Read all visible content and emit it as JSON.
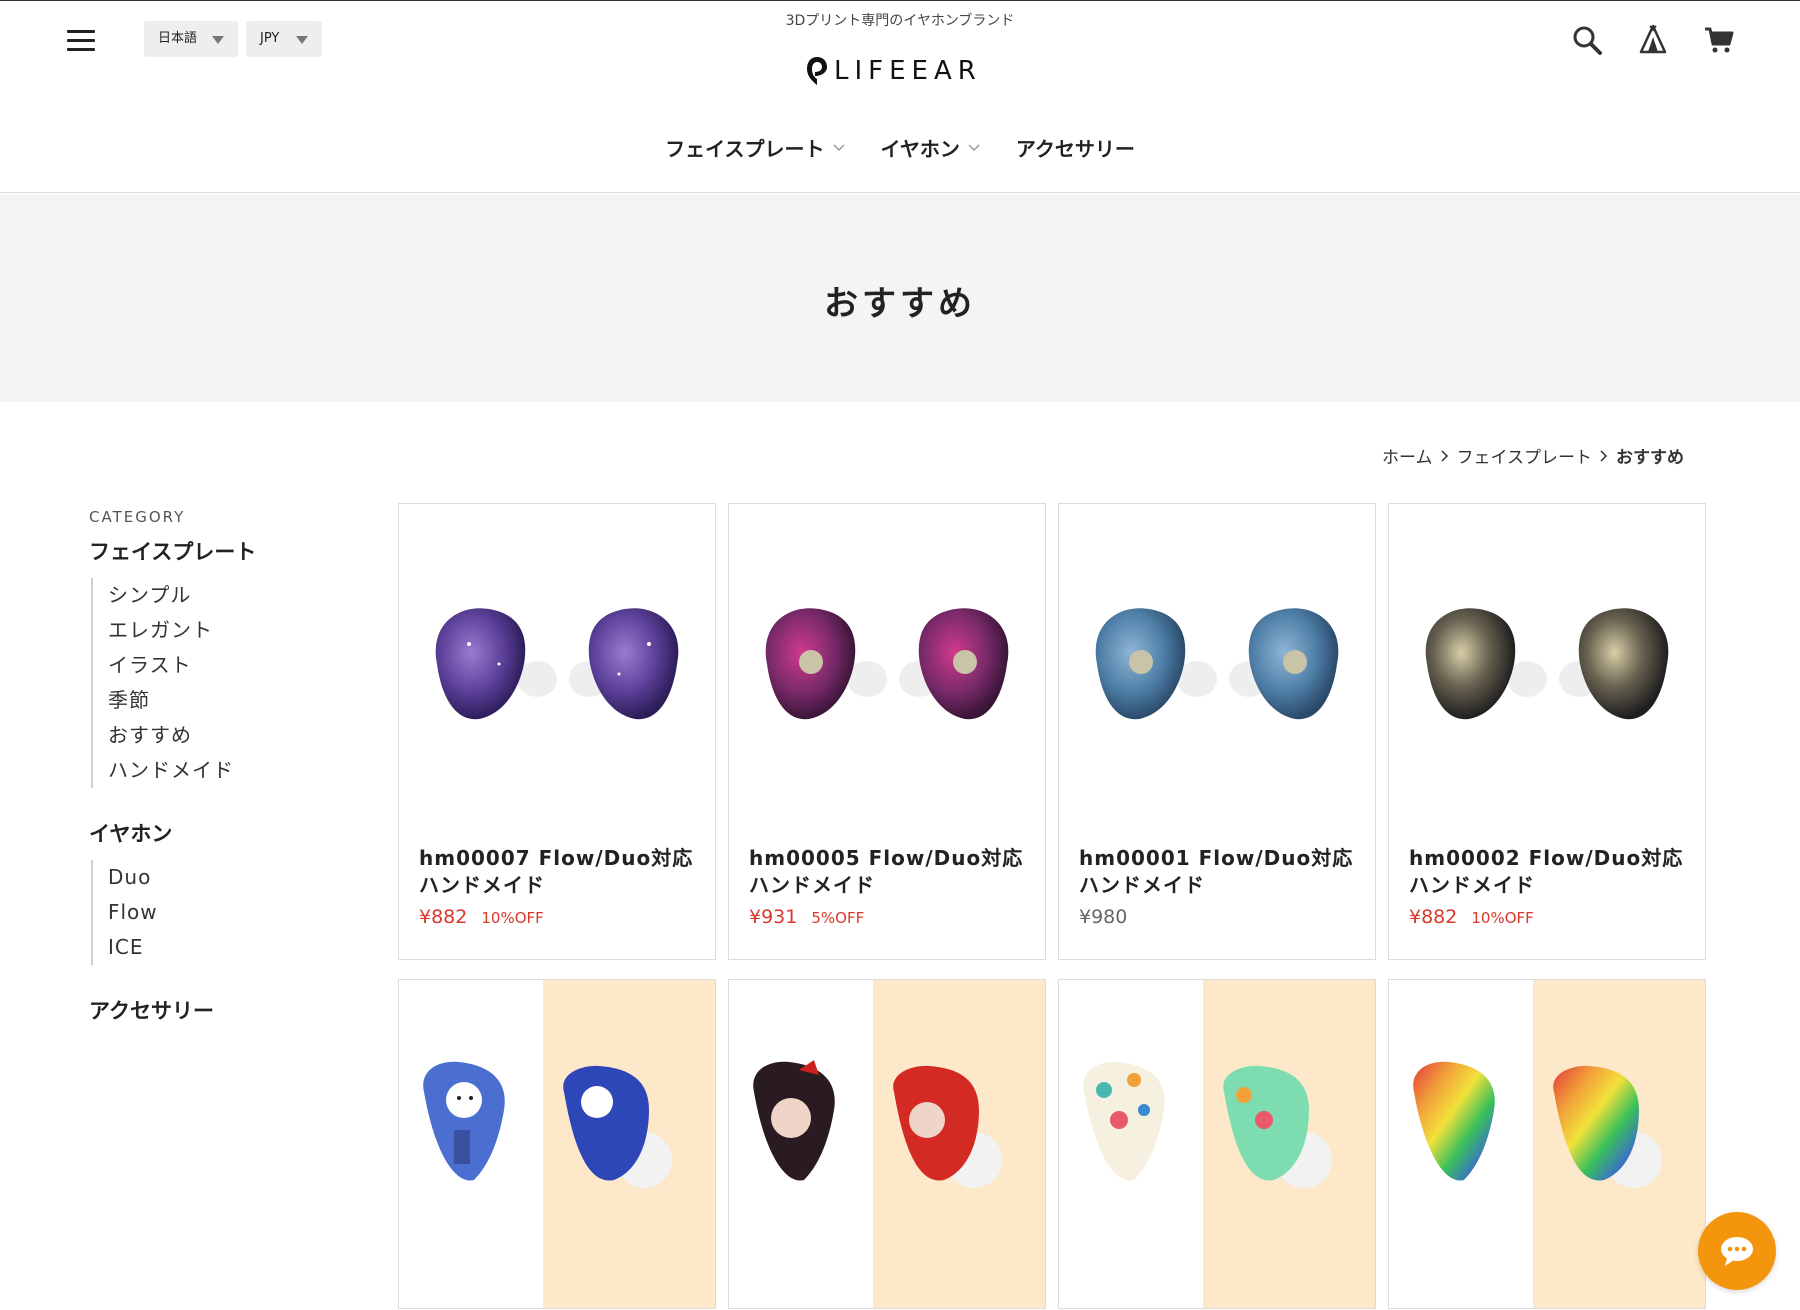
{
  "header": {
    "tagline": "3Dプリント専門のイヤホンブランド",
    "logo_text": "LIFEEAR",
    "language": "日本語",
    "currency": "JPY",
    "icons": [
      "menu-icon",
      "search-icon",
      "tent-icon",
      "cart-icon"
    ]
  },
  "nav": [
    {
      "label": "フェイスプレート",
      "has_dropdown": true
    },
    {
      "label": "イヤホン",
      "has_dropdown": true
    },
    {
      "label": "アクセサリー",
      "has_dropdown": false
    }
  ],
  "hero": {
    "title": "おすすめ"
  },
  "breadcrumb": {
    "home": "ホーム",
    "parent": "フェイスプレート",
    "current": "おすすめ"
  },
  "sidebar": {
    "heading": "CATEGORY",
    "groups": [
      {
        "title": "フェイスプレート",
        "items": [
          "シンプル",
          "エレガント",
          "イラスト",
          "季節",
          "おすすめ",
          "ハンドメイド"
        ]
      },
      {
        "title": "イヤホン",
        "items": [
          "Duo",
          "Flow",
          "ICE"
        ]
      },
      {
        "title": "アクセサリー",
        "items": []
      }
    ]
  },
  "products": [
    {
      "title": "hm00007 Flow/Duo対応 ハンドメイド",
      "price": "¥882",
      "discount": "10%OFF",
      "on_sale": true
    },
    {
      "title": "hm00005 Flow/Duo対応 ハンドメイド",
      "price": "¥931",
      "discount": "5%OFF",
      "on_sale": true
    },
    {
      "title": "hm00001 Flow/Duo対応 ハンドメイド",
      "price": "¥980",
      "discount": "",
      "on_sale": false
    },
    {
      "title": "hm00002 Flow/Duo対応 ハンドメイド",
      "price": "¥882",
      "discount": "10%OFF",
      "on_sale": true
    }
  ],
  "colors": {
    "sale_red": "#d9382a",
    "chat_orange": "#f4960d",
    "hero_bg": "#f4f4f4",
    "peach_bg": "#fde9c9"
  }
}
